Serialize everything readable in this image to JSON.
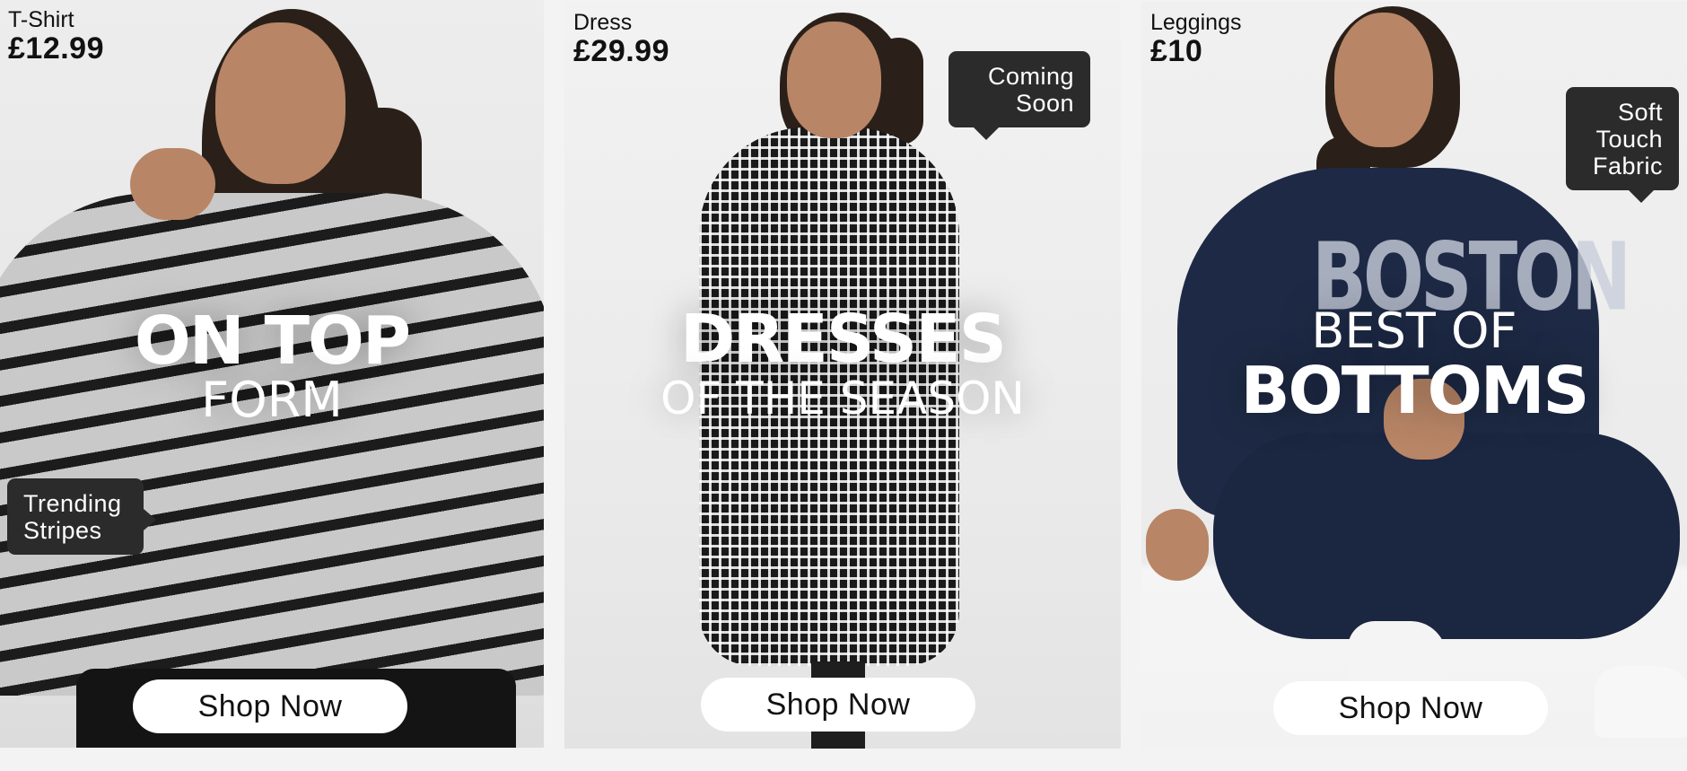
{
  "panels": [
    {
      "product_name": "T-Shirt",
      "price": "£12.99",
      "tag": "Trending Stripes",
      "headline_line1": "ON TOP",
      "headline_line2": "FORM",
      "button_label": "Shop Now"
    },
    {
      "product_name": "Dress",
      "price": "£29.99",
      "tag": "Coming Soon",
      "headline_line1": "DRESSES",
      "headline_line2": "OF THE SEASON",
      "button_label": "Shop Now"
    },
    {
      "product_name": "Leggings",
      "price": "£10",
      "tag": "Soft Touch Fabric",
      "headline_line1": "BEST OF",
      "headline_line2": "BOTTOMS",
      "button_label": "Shop Now"
    }
  ],
  "sweatshirt_print": "BOSTON",
  "colors": {
    "tag_background": "#2b2b2b",
    "button_background": "#ffffff",
    "headline": "#ffffff"
  }
}
